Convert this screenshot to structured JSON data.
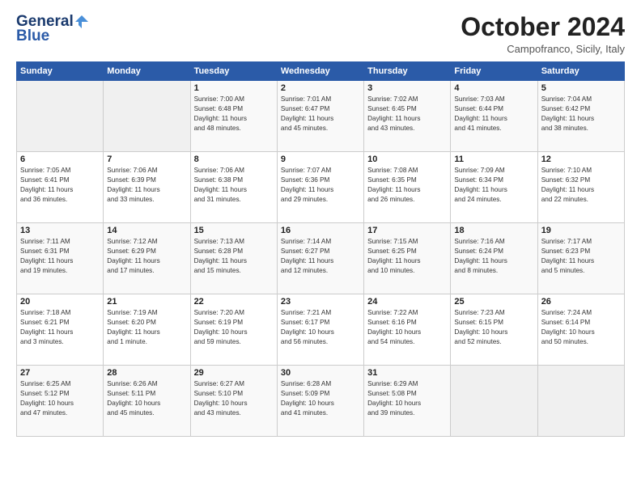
{
  "header": {
    "title": "October 2024",
    "subtitle": "Campofranco, Sicily, Italy"
  },
  "calendar": {
    "days": [
      "Sunday",
      "Monday",
      "Tuesday",
      "Wednesday",
      "Thursday",
      "Friday",
      "Saturday"
    ]
  },
  "weeks": [
    [
      {
        "day": "",
        "info": ""
      },
      {
        "day": "",
        "info": ""
      },
      {
        "day": "1",
        "info": "Sunrise: 7:00 AM\nSunset: 6:48 PM\nDaylight: 11 hours\nand 48 minutes."
      },
      {
        "day": "2",
        "info": "Sunrise: 7:01 AM\nSunset: 6:47 PM\nDaylight: 11 hours\nand 45 minutes."
      },
      {
        "day": "3",
        "info": "Sunrise: 7:02 AM\nSunset: 6:45 PM\nDaylight: 11 hours\nand 43 minutes."
      },
      {
        "day": "4",
        "info": "Sunrise: 7:03 AM\nSunset: 6:44 PM\nDaylight: 11 hours\nand 41 minutes."
      },
      {
        "day": "5",
        "info": "Sunrise: 7:04 AM\nSunset: 6:42 PM\nDaylight: 11 hours\nand 38 minutes."
      }
    ],
    [
      {
        "day": "6",
        "info": "Sunrise: 7:05 AM\nSunset: 6:41 PM\nDaylight: 11 hours\nand 36 minutes."
      },
      {
        "day": "7",
        "info": "Sunrise: 7:06 AM\nSunset: 6:39 PM\nDaylight: 11 hours\nand 33 minutes."
      },
      {
        "day": "8",
        "info": "Sunrise: 7:06 AM\nSunset: 6:38 PM\nDaylight: 11 hours\nand 31 minutes."
      },
      {
        "day": "9",
        "info": "Sunrise: 7:07 AM\nSunset: 6:36 PM\nDaylight: 11 hours\nand 29 minutes."
      },
      {
        "day": "10",
        "info": "Sunrise: 7:08 AM\nSunset: 6:35 PM\nDaylight: 11 hours\nand 26 minutes."
      },
      {
        "day": "11",
        "info": "Sunrise: 7:09 AM\nSunset: 6:34 PM\nDaylight: 11 hours\nand 24 minutes."
      },
      {
        "day": "12",
        "info": "Sunrise: 7:10 AM\nSunset: 6:32 PM\nDaylight: 11 hours\nand 22 minutes."
      }
    ],
    [
      {
        "day": "13",
        "info": "Sunrise: 7:11 AM\nSunset: 6:31 PM\nDaylight: 11 hours\nand 19 minutes."
      },
      {
        "day": "14",
        "info": "Sunrise: 7:12 AM\nSunset: 6:29 PM\nDaylight: 11 hours\nand 17 minutes."
      },
      {
        "day": "15",
        "info": "Sunrise: 7:13 AM\nSunset: 6:28 PM\nDaylight: 11 hours\nand 15 minutes."
      },
      {
        "day": "16",
        "info": "Sunrise: 7:14 AM\nSunset: 6:27 PM\nDaylight: 11 hours\nand 12 minutes."
      },
      {
        "day": "17",
        "info": "Sunrise: 7:15 AM\nSunset: 6:25 PM\nDaylight: 11 hours\nand 10 minutes."
      },
      {
        "day": "18",
        "info": "Sunrise: 7:16 AM\nSunset: 6:24 PM\nDaylight: 11 hours\nand 8 minutes."
      },
      {
        "day": "19",
        "info": "Sunrise: 7:17 AM\nSunset: 6:23 PM\nDaylight: 11 hours\nand 5 minutes."
      }
    ],
    [
      {
        "day": "20",
        "info": "Sunrise: 7:18 AM\nSunset: 6:21 PM\nDaylight: 11 hours\nand 3 minutes."
      },
      {
        "day": "21",
        "info": "Sunrise: 7:19 AM\nSunset: 6:20 PM\nDaylight: 11 hours\nand 1 minute."
      },
      {
        "day": "22",
        "info": "Sunrise: 7:20 AM\nSunset: 6:19 PM\nDaylight: 10 hours\nand 59 minutes."
      },
      {
        "day": "23",
        "info": "Sunrise: 7:21 AM\nSunset: 6:17 PM\nDaylight: 10 hours\nand 56 minutes."
      },
      {
        "day": "24",
        "info": "Sunrise: 7:22 AM\nSunset: 6:16 PM\nDaylight: 10 hours\nand 54 minutes."
      },
      {
        "day": "25",
        "info": "Sunrise: 7:23 AM\nSunset: 6:15 PM\nDaylight: 10 hours\nand 52 minutes."
      },
      {
        "day": "26",
        "info": "Sunrise: 7:24 AM\nSunset: 6:14 PM\nDaylight: 10 hours\nand 50 minutes."
      }
    ],
    [
      {
        "day": "27",
        "info": "Sunrise: 6:25 AM\nSunset: 5:12 PM\nDaylight: 10 hours\nand 47 minutes."
      },
      {
        "day": "28",
        "info": "Sunrise: 6:26 AM\nSunset: 5:11 PM\nDaylight: 10 hours\nand 45 minutes."
      },
      {
        "day": "29",
        "info": "Sunrise: 6:27 AM\nSunset: 5:10 PM\nDaylight: 10 hours\nand 43 minutes."
      },
      {
        "day": "30",
        "info": "Sunrise: 6:28 AM\nSunset: 5:09 PM\nDaylight: 10 hours\nand 41 minutes."
      },
      {
        "day": "31",
        "info": "Sunrise: 6:29 AM\nSunset: 5:08 PM\nDaylight: 10 hours\nand 39 minutes."
      },
      {
        "day": "",
        "info": ""
      },
      {
        "day": "",
        "info": ""
      }
    ]
  ]
}
